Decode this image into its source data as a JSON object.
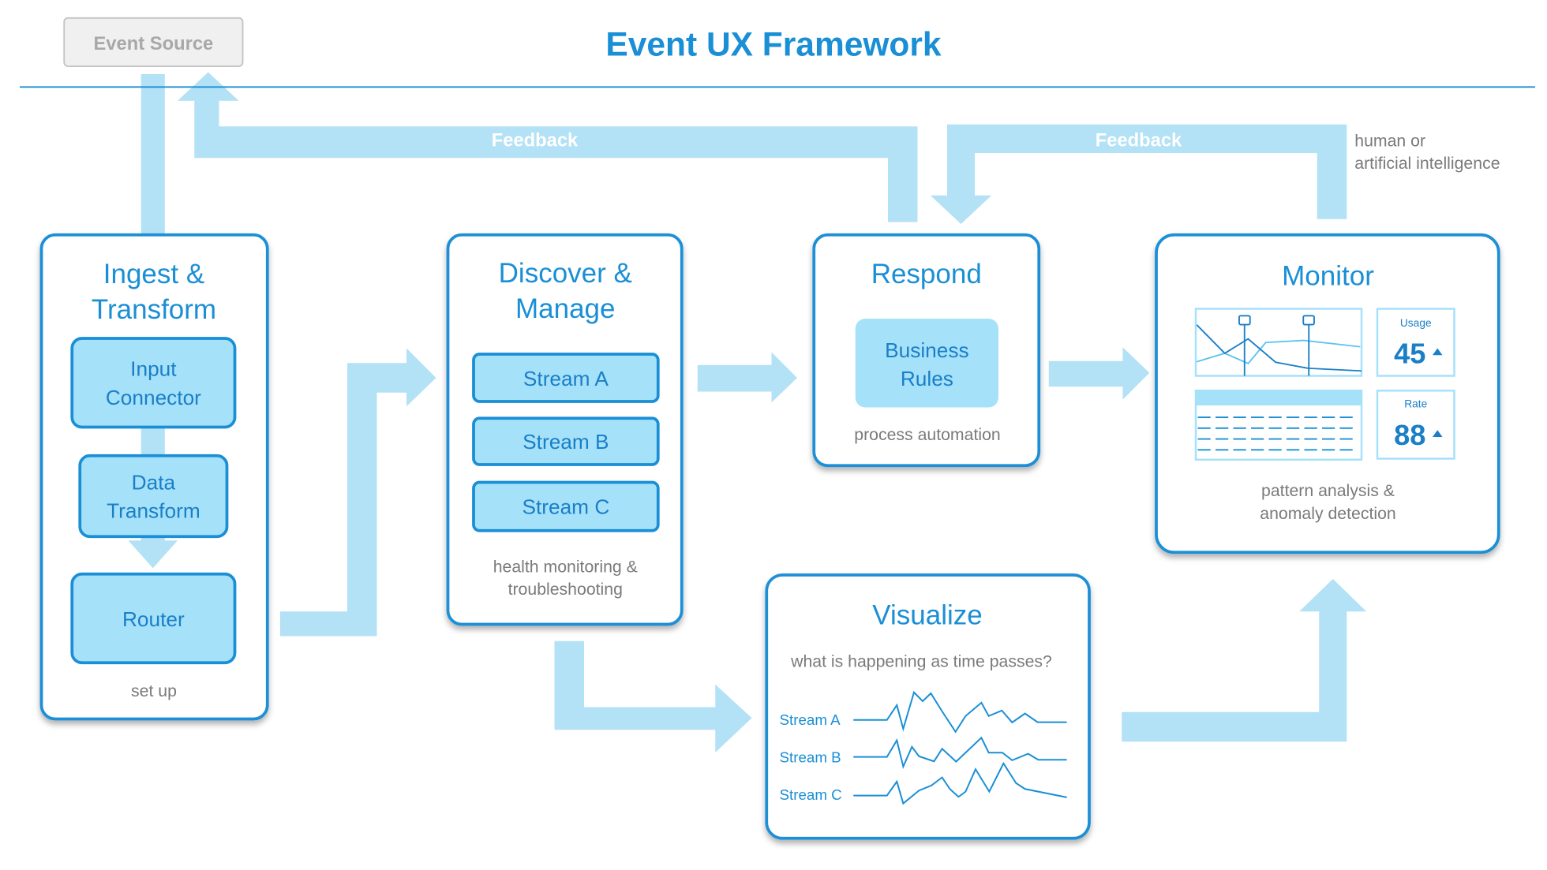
{
  "title": "Event UX Framework",
  "event_source": "Event Source",
  "feedback_left": "Feedback",
  "feedback_right": "Feedback",
  "ai_note": [
    "human or",
    "artificial intelligence"
  ],
  "ingest": {
    "title": [
      "Ingest &",
      "Transform"
    ],
    "input_connector": [
      "Input",
      "Connector"
    ],
    "data_transform": [
      "Data",
      "Transform"
    ],
    "router": "Router",
    "caption": "set up"
  },
  "discover": {
    "title": [
      "Discover &",
      "Manage"
    ],
    "streams": [
      "Stream A",
      "Stream B",
      "Stream C"
    ],
    "caption": [
      "health monitoring &",
      "troubleshooting"
    ]
  },
  "respond": {
    "title": "Respond",
    "business_rules": [
      "Business",
      "Rules"
    ],
    "caption": "process automation"
  },
  "monitor": {
    "title": "Monitor",
    "usage_label": "Usage",
    "usage_value": "45",
    "usage_trend": "up",
    "rate_label": "Rate",
    "rate_value": "88",
    "rate_trend": "up",
    "caption": [
      "pattern analysis &",
      "anomaly detection"
    ]
  },
  "visualize": {
    "title": "Visualize",
    "question": "what is happening as time passes?",
    "streams": [
      "Stream A",
      "Stream B",
      "Stream C"
    ]
  },
  "colors": {
    "accent": "#1a8fd6",
    "arrow": "#b3e1f5",
    "fill": "#a6e1fa",
    "caption": "#7a7a7a"
  }
}
